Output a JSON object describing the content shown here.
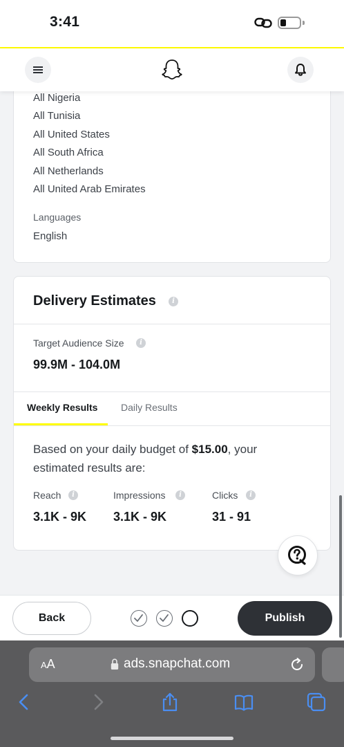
{
  "status_bar": {
    "time": "3:41"
  },
  "header": {
    "logo": "snapchat-ghost-icon",
    "menu_icon": "hamburger-icon",
    "notification_icon": "bell-icon"
  },
  "locations": [
    "All Nigeria",
    "All Tunisia",
    "All United States",
    "All South Africa",
    "All Netherlands",
    "All United Arab Emirates"
  ],
  "languages": {
    "label": "Languages",
    "value": "English"
  },
  "delivery": {
    "title": "Delivery Estimates",
    "audience_label": "Target Audience Size",
    "audience_value": "99.9M - 104.0M",
    "tabs": [
      {
        "label": "Weekly Results",
        "active": true
      },
      {
        "label": "Daily Results",
        "active": false
      }
    ],
    "budget_prefix": "Based on your daily budget of ",
    "budget_amount": "$15.00",
    "budget_suffix": ", your estimated results are:",
    "metrics": [
      {
        "label": "Reach",
        "value": "3.1K - 9K"
      },
      {
        "label": "Impressions",
        "value": "3.1K - 9K"
      },
      {
        "label": "Clicks",
        "value": "31 - 91"
      }
    ]
  },
  "actions": {
    "back_label": "Back",
    "publish_label": "Publish",
    "steps": [
      {
        "state": "done"
      },
      {
        "state": "done"
      },
      {
        "state": "current"
      }
    ]
  },
  "browser": {
    "text_size_label": "AA",
    "url": "ads.snapchat.com",
    "toolbar_icons": [
      "back-icon",
      "forward-icon",
      "share-icon",
      "bookmarks-icon",
      "tabs-icon"
    ]
  },
  "colors": {
    "brand_yellow": "#fffc00",
    "publish_bg": "#2e3136",
    "safari_bg": "#5a5a5c",
    "link_blue": "#4a8ef2"
  }
}
